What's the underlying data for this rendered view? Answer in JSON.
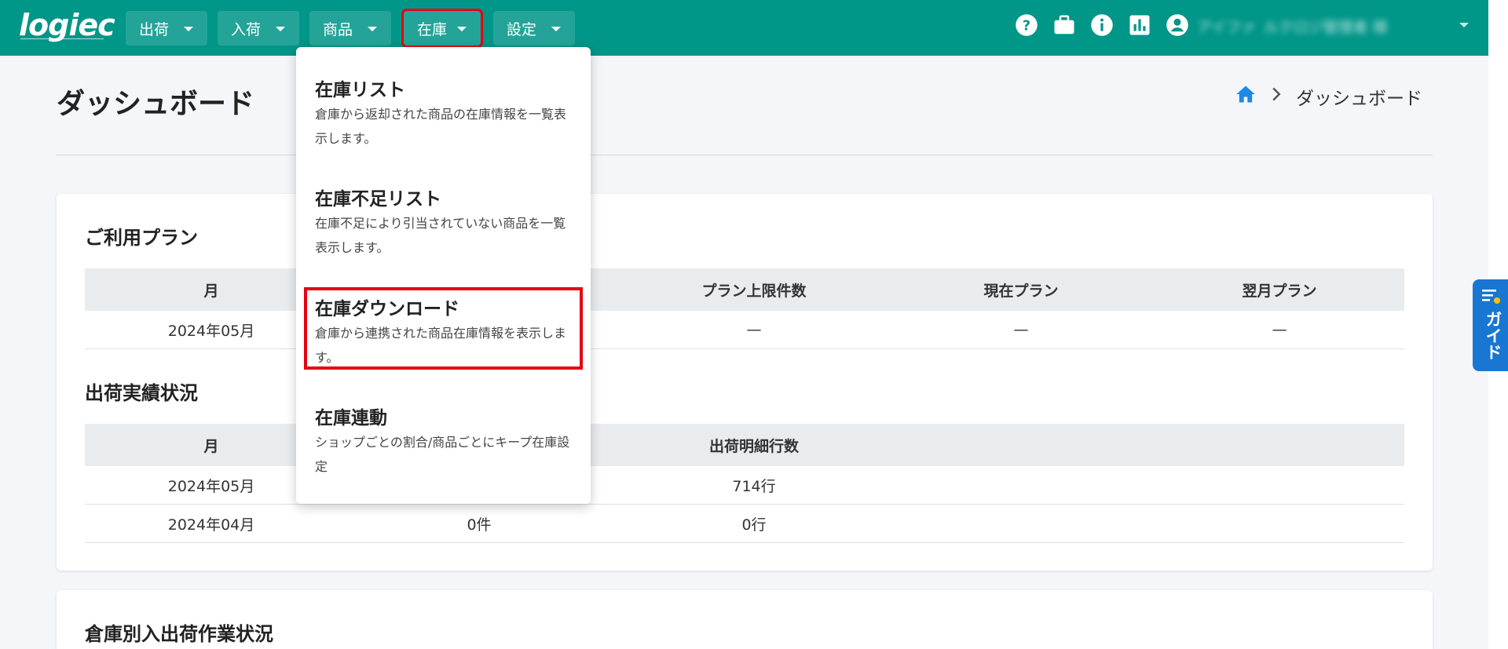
{
  "header": {
    "logo_text": "logiec",
    "nav": [
      {
        "label": "出荷"
      },
      {
        "label": "入荷"
      },
      {
        "label": "商品"
      },
      {
        "label": "在庫"
      },
      {
        "label": "設定"
      }
    ],
    "user_name": "アイファ_ルクロジ管理者 様",
    "icons": [
      "help-icon",
      "briefcase-icon",
      "info-icon",
      "chart-icon",
      "account-icon"
    ]
  },
  "page": {
    "title": "ダッシュボード",
    "breadcrumb_current": "ダッシュボード"
  },
  "plan": {
    "title": "ご利用プラン",
    "headers": [
      "月",
      "",
      "プラン上限件数",
      "現在プラン",
      "翌月プラン"
    ],
    "rows": [
      [
        "2024年05月",
        "",
        "—",
        "—",
        "—"
      ]
    ]
  },
  "shipping": {
    "title": "出荷実績状況",
    "headers": [
      "月",
      "",
      "出荷明細行数"
    ],
    "rows": [
      [
        "2024年05月",
        "",
        "714行"
      ],
      [
        "2024年04月",
        "0件",
        "0行"
      ]
    ]
  },
  "warehouse": {
    "title": "倉庫別入出荷作業状況"
  },
  "dropdown": {
    "items": [
      {
        "title": "在庫リスト",
        "desc": "倉庫から返却された商品の在庫情報を一覧表示します。"
      },
      {
        "title": "在庫不足リスト",
        "desc": "在庫不足により引当されていない商品を一覧表示します。"
      },
      {
        "title": "在庫ダウンロード",
        "desc": "倉庫から連携された商品在庫情報を表示します。"
      },
      {
        "title": "在庫連動",
        "desc": "ショップごとの割合/商品ごとにキープ在庫設定"
      }
    ]
  },
  "guide": {
    "label": "ガイド"
  },
  "colors": {
    "header_bg": "#009688",
    "highlight": "#e60012",
    "guide_bg": "#1976d2",
    "home_icon": "#1e88e5"
  }
}
